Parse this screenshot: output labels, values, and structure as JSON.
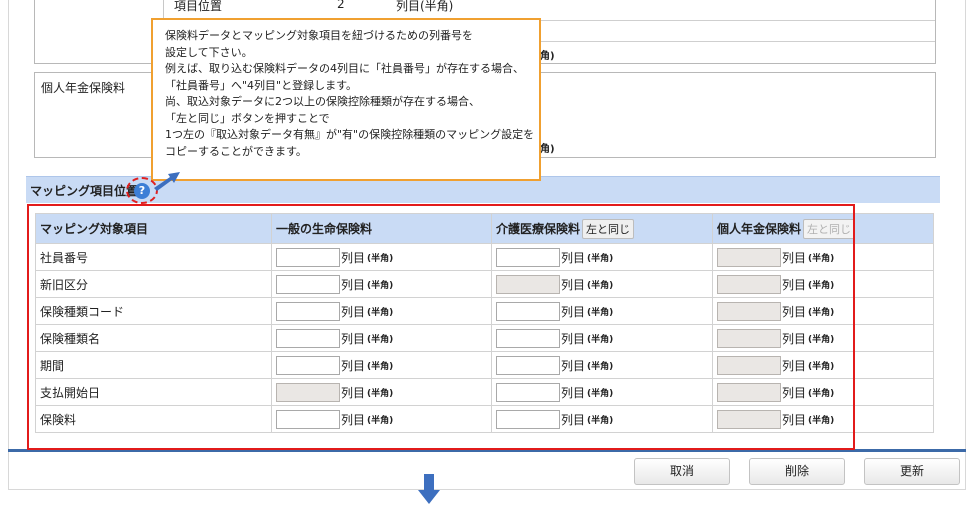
{
  "background_rows": {
    "top_row_label": "項目位置",
    "top_row_value": "2",
    "top_row_unit": "列目(半角)",
    "partial_half": "角)",
    "pension_label": "個人年金保険料",
    "pension_partial_half": "角)"
  },
  "tooltip": {
    "lines": [
      "保険料データとマッピング対象項目を紐づけるための列番号を",
      "設定して下さい。",
      "例えば、取り込む保険料データの4列目に「社員番号」が存在する場合、",
      "「社員番号」へ\"4列目\"と登録します。",
      "尚、取込対象データに2つ以上の保険控除種類が存在する場合、",
      "「左と同じ」ボタンを押すことで",
      "1つ左の『取込対象データ有無』が\"有\"の保険控除種類のマッピング設定を",
      "コピーすることができます。"
    ]
  },
  "section": {
    "title": "マッピング項目位置",
    "help_icon": "question-circle-icon"
  },
  "table": {
    "headers": [
      "マッピング対象項目",
      "一般の生命保険料",
      "介護医療保険料",
      "個人年金保険料"
    ],
    "same_as_left": "左と同じ",
    "unit": "列目",
    "half_width": "(半角)",
    "rows": [
      {
        "label": "社員番号",
        "enabled": [
          true,
          true,
          false
        ]
      },
      {
        "label": "新旧区分",
        "enabled": [
          true,
          false,
          false
        ]
      },
      {
        "label": "保険種類コード",
        "enabled": [
          true,
          true,
          false
        ]
      },
      {
        "label": "保険種類名",
        "enabled": [
          true,
          true,
          false
        ]
      },
      {
        "label": "期間",
        "enabled": [
          true,
          true,
          false
        ]
      },
      {
        "label": "支払開始日",
        "enabled": [
          false,
          true,
          false
        ]
      },
      {
        "label": "保険料",
        "enabled": [
          true,
          true,
          false
        ]
      }
    ]
  },
  "buttons": {
    "cancel": "取消",
    "delete": "削除",
    "update": "更新"
  },
  "colors": {
    "header_bg": "#c9dbf5",
    "highlight_red": "#e21b1b",
    "tooltip_border": "#f0a030",
    "accent_blue": "#3c6aa8"
  }
}
